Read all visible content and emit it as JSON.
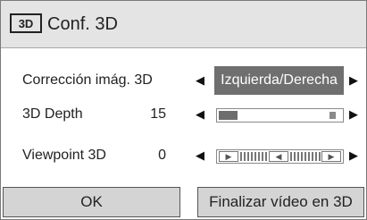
{
  "window": {
    "title": "Conf. 3D",
    "icon": "3d-icon"
  },
  "rows": {
    "correction": {
      "label": "Corrección imág. 3D",
      "value": "Izquierda/Derecha"
    },
    "depth": {
      "label": "3D Depth",
      "value": "15",
      "level": 0.15
    },
    "viewpoint": {
      "label": "Viewpoint 3D",
      "value": "0"
    }
  },
  "buttons": {
    "ok": "OK",
    "finish": "Finalizar vídeo en 3D"
  },
  "colors": {
    "title_bg": "#e4e4e4",
    "selected_bg": "#6f6f6f",
    "button_bg": "#d4d4d4"
  }
}
